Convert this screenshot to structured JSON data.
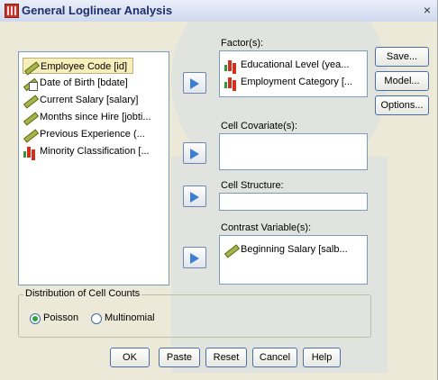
{
  "window": {
    "title": "General Loglinear Analysis",
    "close": "×"
  },
  "variables": [
    {
      "label": "Employee Code [id]",
      "icon": "scale-icon",
      "selected": true
    },
    {
      "label": "Date of Birth [bdate]",
      "icon": "date-scale-icon",
      "selected": false
    },
    {
      "label": "Current Salary [salary]",
      "icon": "scale-icon",
      "selected": false
    },
    {
      "label": "Months since Hire [jobti...",
      "icon": "scale-icon",
      "selected": false
    },
    {
      "label": "Previous Experience (...",
      "icon": "scale-icon",
      "selected": false
    },
    {
      "label": "Minority Classification [...",
      "icon": "nominal-icon",
      "selected": false
    }
  ],
  "factor": {
    "label": "Factor(s):",
    "items": [
      {
        "label": "Educational Level (yea...",
        "icon": "nominal-icon"
      },
      {
        "label": "Employment Category [...",
        "icon": "nominal-icon"
      }
    ]
  },
  "cell_covariate": {
    "label": "Cell Covariate(s):"
  },
  "cell_structure": {
    "label": "Cell Structure:"
  },
  "contrast": {
    "label": "Contrast Variable(s):",
    "items": [
      {
        "label": "Beginning Salary [salb...",
        "icon": "scale-icon"
      }
    ]
  },
  "side_buttons": {
    "save": "Save...",
    "model": "Model...",
    "options": "Options..."
  },
  "distribution": {
    "title": "Distribution of Cell Counts",
    "poisson": "Poisson",
    "multinomial": "Multinomial",
    "selected": "Poisson"
  },
  "bottom_buttons": {
    "ok": "OK",
    "paste": "Paste",
    "reset": "Reset",
    "cancel": "Cancel",
    "help": "Help"
  },
  "colors": {
    "accent": "#3b7fd4",
    "selection": "#f6efbb",
    "window_bg": "#ece9d8"
  }
}
